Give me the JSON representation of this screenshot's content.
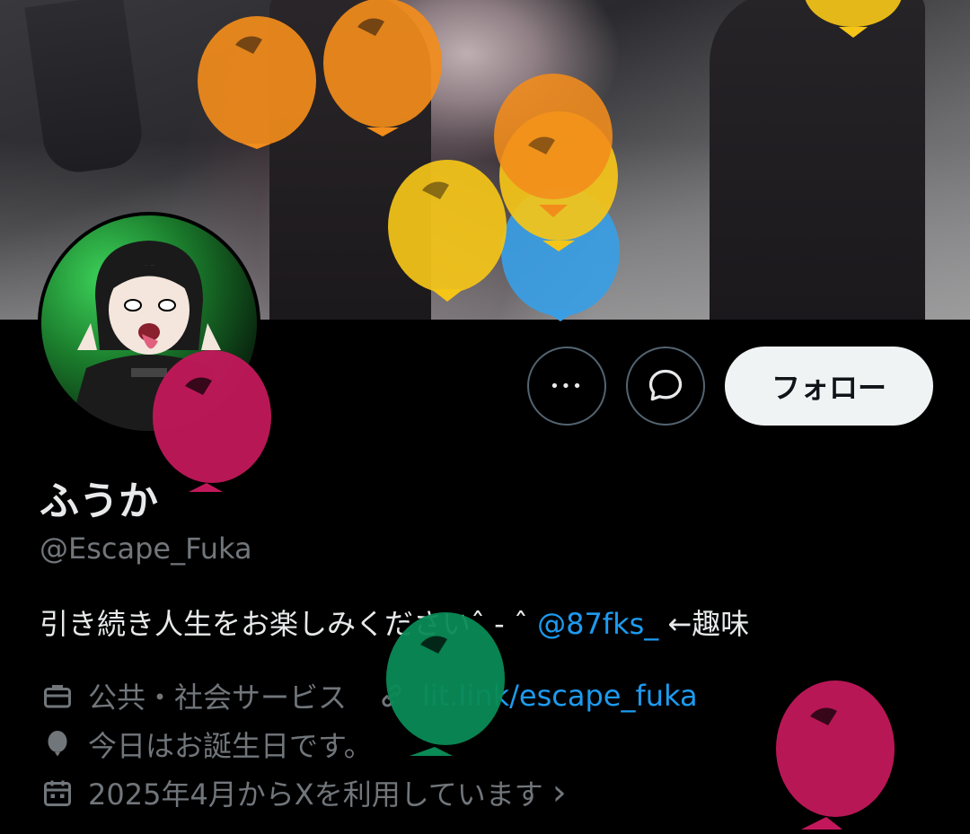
{
  "profile": {
    "display_name": "ふうか",
    "handle": "@Escape_Fuka",
    "bio_text": "引き続き人生をお楽しみくださいˆ - ˆ",
    "bio_mention": "@87fks_",
    "bio_suffix": "←趣味",
    "category": "公共・社会サービス",
    "website": "lit.link/escape_fuka",
    "location": "今日はお誕生日です。",
    "joined": "2025年4月からXを利用しています",
    "joined_chevron": "›"
  },
  "actions": {
    "more_label": "•••",
    "follow_label": "フォロー"
  },
  "icons": {
    "more": "more-icon",
    "message": "message-icon",
    "category": "briefcase-icon",
    "website": "link-icon",
    "location": "balloon-icon",
    "joined": "calendar-icon"
  },
  "colors": {
    "background": "#000000",
    "text_primary": "#e7e9ea",
    "text_secondary": "#71767b",
    "accent": "#1d9bf0",
    "follow_bg": "#eff3f4",
    "balloon_orange": "#f28c1b",
    "balloon_yellow": "#f5c518",
    "balloon_blue": "#3a9ee4",
    "balloon_pink": "#c2185b",
    "balloon_green": "#0a8a55"
  }
}
